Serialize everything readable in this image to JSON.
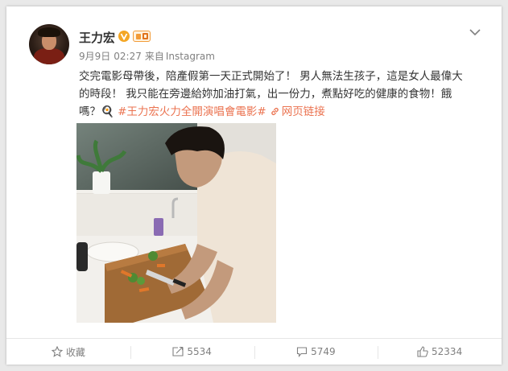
{
  "user": {
    "name": "王力宏",
    "avatar": "avatar"
  },
  "meta": {
    "date": "9月9日",
    "time": "02:27",
    "source_prefix": "来自",
    "source": "Instagram"
  },
  "post": {
    "line1": "交完電影母帶後，陪產假第一天正式開始了！ 男人無法生孩子，這是女人最偉大",
    "line2": "的時段！ 我只能在旁邊給妳加油打氣，出一份力，煮點好吃的健康的食物！餓",
    "line3_prefix": "嗎？🍳 ",
    "hashtag": "#王力宏火力全開演唱會電影#",
    "link_label": "网页链接"
  },
  "photo": {
    "description": "man chopping vegetables in kitchen"
  },
  "actions": {
    "favorite_label": "收藏",
    "repost_count": "5534",
    "comment_count": "5749",
    "like_count": "52334"
  },
  "colors": {
    "accent": "#eb7350",
    "verified": "#f4a623",
    "muted": "#808080"
  }
}
